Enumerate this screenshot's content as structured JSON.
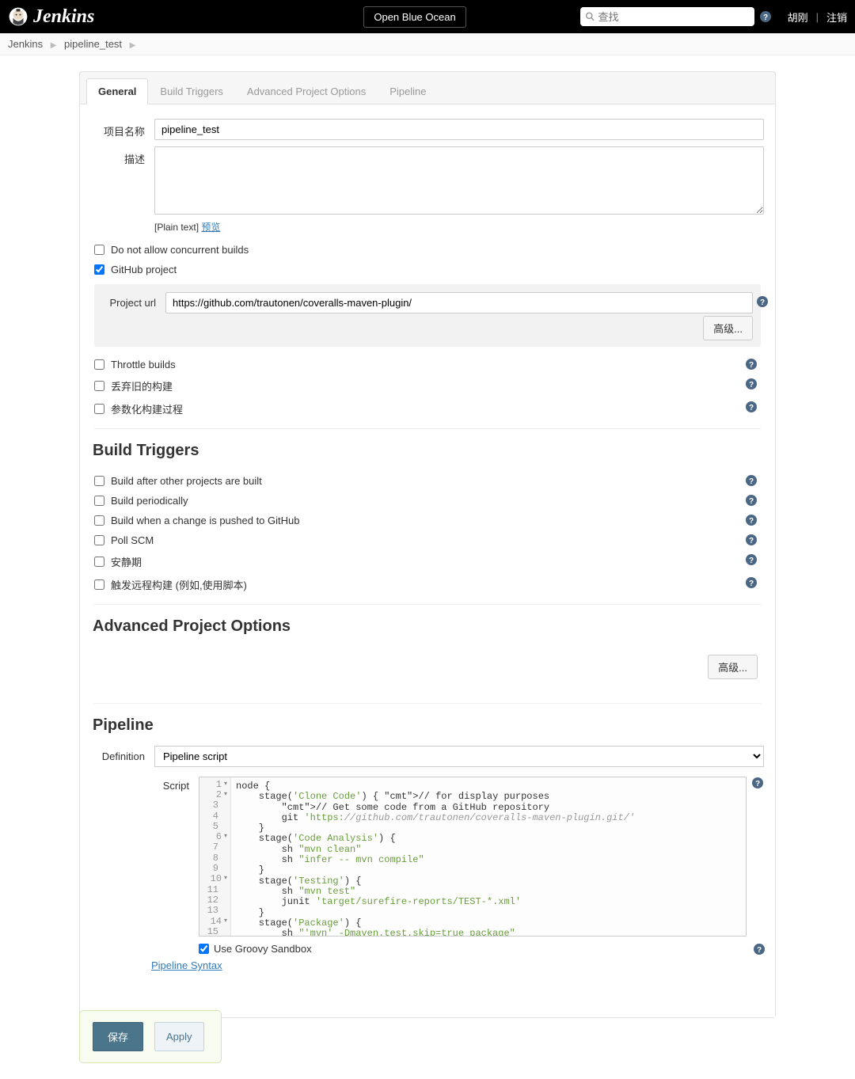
{
  "header": {
    "title": "Jenkins",
    "blue_ocean": "Open Blue Ocean",
    "search_placeholder": "查找",
    "user": "胡刚",
    "logout": "注销"
  },
  "breadcrumb": {
    "root": "Jenkins",
    "item": "pipeline_test"
  },
  "tabs": [
    "General",
    "Build Triggers",
    "Advanced Project Options",
    "Pipeline"
  ],
  "general": {
    "project_name_label": "项目名称",
    "project_name": "pipeline_test",
    "description_label": "描述",
    "description": "",
    "plain_text": "[Plain text]",
    "preview": "预览",
    "cb_no_concurrent": "Do not allow concurrent builds",
    "cb_github_project": "GitHub project",
    "project_url_label": "Project url",
    "project_url": "https://github.com/trautonen/coveralls-maven-plugin/",
    "advanced_btn": "高级...",
    "cb_throttle": "Throttle builds",
    "cb_discard": "丢弃旧的构建",
    "cb_params": "参数化构建过程"
  },
  "build_triggers": {
    "heading": "Build Triggers",
    "items": [
      "Build after other projects are built",
      "Build periodically",
      "Build when a change is pushed to GitHub",
      "Poll SCM",
      "安静期",
      "触发远程构建 (例如,使用脚本)"
    ]
  },
  "adv_options": {
    "heading": "Advanced Project Options",
    "advanced_btn": "高级..."
  },
  "pipeline": {
    "heading": "Pipeline",
    "definition_label": "Definition",
    "definition_value": "Pipeline script",
    "script_label": "Script",
    "sandbox_label": "Use Groovy Sandbox",
    "syntax_link": "Pipeline Syntax",
    "code_lines": [
      {
        "n": 1,
        "raw": "node {",
        "fold": true
      },
      {
        "n": 2,
        "raw": "    stage('Clone Code') { // for display purposes",
        "fold": true
      },
      {
        "n": 3,
        "raw": "        // Get some code from a GitHub repository"
      },
      {
        "n": 4,
        "raw": "        git 'https://github.com/trautonen/coveralls-maven-plugin.git/'"
      },
      {
        "n": 5,
        "raw": "    }"
      },
      {
        "n": 6,
        "raw": "    stage('Code Analysis') {",
        "fold": true
      },
      {
        "n": 7,
        "raw": "        sh \"mvn clean\""
      },
      {
        "n": 8,
        "raw": "        sh \"infer -- mvn compile\""
      },
      {
        "n": 9,
        "raw": "    }"
      },
      {
        "n": 10,
        "raw": "    stage('Testing') {",
        "fold": true
      },
      {
        "n": 11,
        "raw": "        sh \"mvn test\""
      },
      {
        "n": 12,
        "raw": "        junit 'target/surefire-reports/TEST-*.xml'"
      },
      {
        "n": 13,
        "raw": "    }"
      },
      {
        "n": 14,
        "raw": "    stage('Package') {",
        "fold": true
      },
      {
        "n": 15,
        "raw": "        sh \"'mvn' -Dmaven.test.skip=true package\""
      }
    ]
  },
  "footer": {
    "save": "保存",
    "apply": "Apply"
  }
}
